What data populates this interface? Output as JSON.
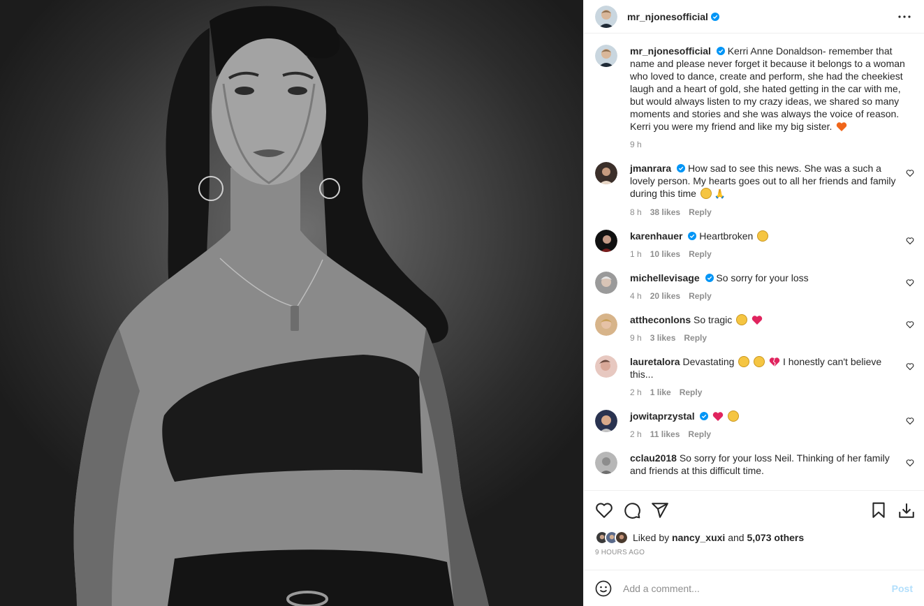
{
  "header": {
    "username": "mr_njonesofficial",
    "more_icon": "more-horizontal-icon"
  },
  "caption": {
    "username": "mr_njonesofficial",
    "text": "Kerri Anne Donaldson- remember that name and please never forget it because it belongs to a woman who loved to dance, create and perform, she had the cheekiest laugh and a heart of gold, she hated getting in the car with me, but would always listen to my crazy ideas, we shared so many moments and stories and she was always the voice of reason. Kerri you were my friend and like my big sister.",
    "emoji": "orange-heart",
    "time": "9 h"
  },
  "comments": [
    {
      "username": "jmanrara",
      "verified": true,
      "text": "How sad to see this news. She was a such a lovely person. My hearts goes out to all her friends and family during this time",
      "time": "8 h",
      "likes": "38 likes",
      "reply": "Reply"
    },
    {
      "username": "karenhauer",
      "verified": true,
      "text": "Heartbroken",
      "time": "1 h",
      "likes": "10 likes",
      "reply": "Reply"
    },
    {
      "username": "michellevisage",
      "verified": true,
      "text": "So sorry for your loss",
      "time": "4 h",
      "likes": "20 likes",
      "reply": "Reply"
    },
    {
      "username": "attheconlons",
      "verified": false,
      "text": "So tragic",
      "time": "9 h",
      "likes": "3 likes",
      "reply": "Reply"
    },
    {
      "username": "lauretalora",
      "verified": false,
      "text": "Devastating",
      "text2": "I honestly can't believe this...",
      "time": "2 h",
      "likes": "1 like",
      "reply": "Reply"
    },
    {
      "username": "jowitaprzystal",
      "verified": true,
      "text": "",
      "time": "2 h",
      "likes": "11 likes",
      "reply": "Reply"
    },
    {
      "username": "cclau2018",
      "verified": false,
      "text": "So sorry for your loss Neil. Thinking of her family and friends at this difficult time."
    }
  ],
  "likes": {
    "prefix": "Liked by",
    "user": "nancy_xuxi",
    "and": "and",
    "others": "5,073 others"
  },
  "posted": "9 HOURS AGO",
  "add_comment": {
    "placeholder": "Add a comment...",
    "post_label": "Post"
  },
  "colors": {
    "verified": "#0095f6",
    "post_disabled": "#b2dffc",
    "meta": "#8e8e8e"
  }
}
